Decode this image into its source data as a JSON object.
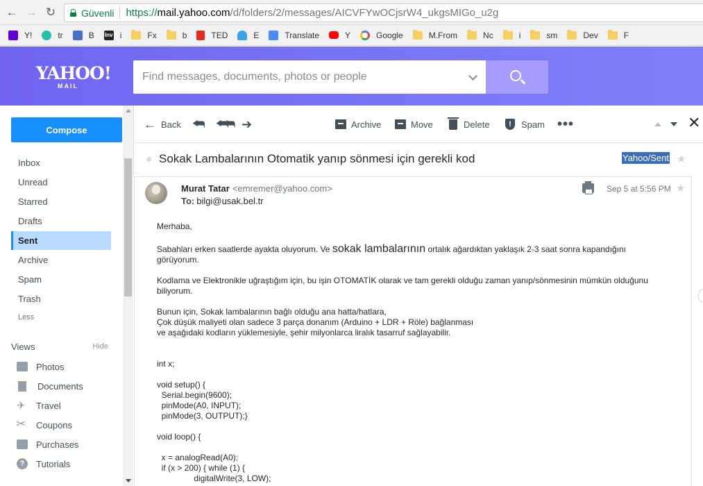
{
  "browser": {
    "secure_label": "Güvenli",
    "url_scheme": "https://",
    "url_host": "mail.yahoo.com",
    "url_path": "/d/folders/2/messages/AICVFYwOCjsrW4_ukgsMIGo_u2g",
    "bookmarks": [
      {
        "label": "Y!",
        "icon": "yahoo-icon"
      },
      {
        "label": "tr",
        "icon": "circle-icon"
      },
      {
        "label": "B",
        "icon": "b-icon"
      },
      {
        "label": "i",
        "icon": "inv-icon"
      },
      {
        "label": "Fx",
        "icon": "folder-icon"
      },
      {
        "label": "b",
        "icon": "folder-icon"
      },
      {
        "label": "TED",
        "icon": "ted-icon"
      },
      {
        "label": "E",
        "icon": "cloud-icon"
      },
      {
        "label": "Translate",
        "icon": "translate-icon"
      },
      {
        "label": "Y",
        "icon": "youtube-icon"
      },
      {
        "label": "Google",
        "icon": "google-icon"
      },
      {
        "label": "M.From",
        "icon": "folder-icon"
      },
      {
        "label": "Nc",
        "icon": "folder-icon"
      },
      {
        "label": "i",
        "icon": "folder-icon"
      },
      {
        "label": "sm",
        "icon": "folder-icon"
      },
      {
        "label": "Dev",
        "icon": "folder-icon"
      },
      {
        "label": "F",
        "icon": "folder-icon"
      }
    ]
  },
  "header": {
    "logo_main": "YAHOO!",
    "logo_sub": "MAIL",
    "search_placeholder": "Find messages, documents, photos or people"
  },
  "sidebar": {
    "compose_label": "Compose",
    "folders": [
      "Inbox",
      "Unread",
      "Starred",
      "Drafts",
      "Sent",
      "Archive",
      "Spam",
      "Trash"
    ],
    "active_folder": "Sent",
    "less_label": "Less",
    "views_label": "Views",
    "hide_label": "Hide",
    "views": [
      "Photos",
      "Documents",
      "Travel",
      "Coupons",
      "Purchases",
      "Tutorials"
    ]
  },
  "toolbar": {
    "back": "Back",
    "archive": "Archive",
    "move": "Move",
    "delete": "Delete",
    "spam": "Spam",
    "more": "•••"
  },
  "message": {
    "subject": "Sokak Lambalarının Otomatik yanıp sönmesi için gerekli kod",
    "folder_tag": "Yahoo/Sent",
    "sender_name": "Murat Tatar",
    "sender_email": "<emremer@yahoo.com>",
    "to_label": "To:",
    "to_address": "bilgi@usak.bel.tr",
    "date": "Sep 5 at 5:56 PM",
    "greeting": "Merhaba,",
    "p1_a": "Sabahları erken saatlerde ayakta oluyorum. Ve ",
    "p1_big": "sokak lambalarının",
    "p1_b": " ortalık ağardıktan yaklaşık 2-3 saat sonra kapandığını görüyorum.",
    "p2": "Kodlama ve Elektronikle uğraştığım için, bu işin OTOMATİK olarak ve tam gerekli olduğu zaman yanıp/sönmesinin mümkün olduğunu biliyorum.",
    "p3_l1": "Bunun için, Sokak lambalarının bağlı olduğu ana hatta/hatlara,",
    "p3_l2": "Çok düşük maliyeti olan sadece 3 parça donanım (Arduino + LDR + Röle) bağlanması",
    "p3_l3": "ve aşağıdaki kodların yüklemesiyle, şehir milyonlarca liralık tasarruf sağlayabilir.",
    "code_1": "int x;",
    "code_2": "void setup() {\n  Serial.begin(9600);\n  pinMode(A0, INPUT);\n  pinMode(3, OUTPUT);}",
    "code_3": "void loop() {",
    "code_4": "  x = analogRead(A0);\n  if (x > 200) { while (1) {\n                digitalWrite(3, LOW);"
  }
}
